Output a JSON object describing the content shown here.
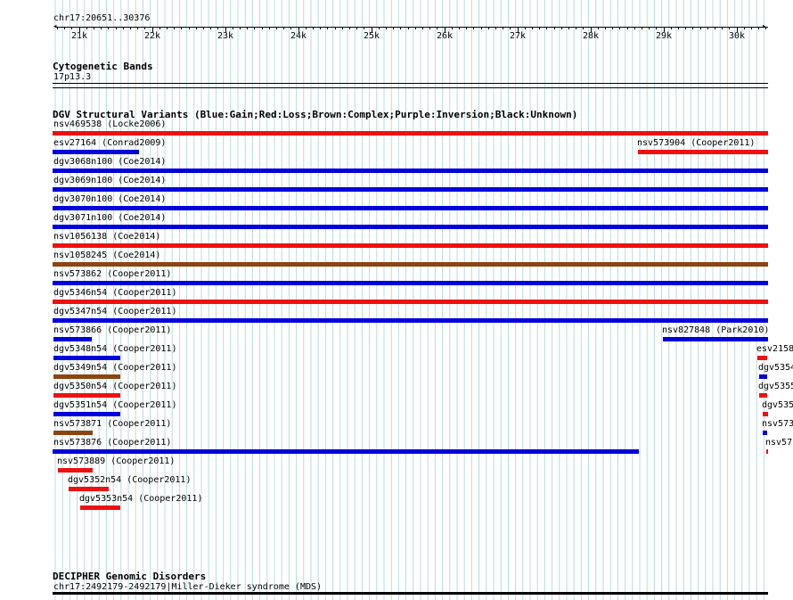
{
  "position_label": "chr17:20651..30376",
  "ruler": {
    "ticks": [
      "21k",
      "22k",
      "23k",
      "24k",
      "25k",
      "26k",
      "27k",
      "28k",
      "29k",
      "30k"
    ]
  },
  "cytoband": {
    "title": "Cytogenetic Bands",
    "band_label": "17p13.3"
  },
  "dgv": {
    "title": "DGV Structural Variants (Blue:Gain;Red:Loss;Brown:Complex;Purple:Inversion;Black:Unknown)",
    "colors": {
      "gain": "#0000dd",
      "loss": "#ee1111",
      "complex": "#8b4513"
    },
    "features": [
      {
        "label": "nsv469538 (Locke2006)",
        "type": "loss"
      },
      {
        "label": "esv27164 (Conrad2009)",
        "type": "gain"
      },
      {
        "label": "nsv573904 (Cooper2011)",
        "type": "loss"
      },
      {
        "label": "dgv3068n100 (Coe2014)",
        "type": "gain"
      },
      {
        "label": "dgv3069n100 (Coe2014)",
        "type": "gain"
      },
      {
        "label": "dgv3070n100 (Coe2014)",
        "type": "gain"
      },
      {
        "label": "dgv3071n100 (Coe2014)",
        "type": "gain"
      },
      {
        "label": "nsv1056138 (Coe2014)",
        "type": "loss"
      },
      {
        "label": "nsv1058245 (Coe2014)",
        "type": "complex"
      },
      {
        "label": "nsv573862 (Cooper2011)",
        "type": "gain"
      },
      {
        "label": "dgv5346n54 (Cooper2011)",
        "type": "loss"
      },
      {
        "label": "dgv5347n54 (Cooper2011)",
        "type": "gain"
      },
      {
        "label": "nsv573866 (Cooper2011)",
        "type": "gain"
      },
      {
        "label": "nsv827848 (Park2010)",
        "type": "gain"
      },
      {
        "label": "dgv5348n54 (Cooper2011)",
        "type": "gain"
      },
      {
        "label": "esv2158",
        "type": "loss"
      },
      {
        "label": "dgv5349n54 (Cooper2011)",
        "type": "complex"
      },
      {
        "label": "dgv5354",
        "type": "gain"
      },
      {
        "label": "dgv5350n54 (Cooper2011)",
        "type": "loss"
      },
      {
        "label": "dgv5355",
        "type": "loss"
      },
      {
        "label": "dgv5351n54 (Cooper2011)",
        "type": "gain"
      },
      {
        "label": "dgv535",
        "type": "loss"
      },
      {
        "label": "nsv573871 (Cooper2011)",
        "type": "complex"
      },
      {
        "label": "nsv573",
        "type": "gain"
      },
      {
        "label": "nsv573876 (Cooper2011)",
        "type": "gain"
      },
      {
        "label": "nsv57",
        "type": "loss"
      },
      {
        "label": "nsv573889 (Cooper2011)",
        "type": "loss"
      },
      {
        "label": "dgv5352n54 (Cooper2011)",
        "type": "loss"
      },
      {
        "label": "dgv5353n54 (Cooper2011)",
        "type": "loss"
      }
    ]
  },
  "decipher": {
    "title": "DECIPHER Genomic Disorders",
    "feature_label": "chr17:2492179-2492179|Miller-Dieker syndrome (MDS)"
  }
}
